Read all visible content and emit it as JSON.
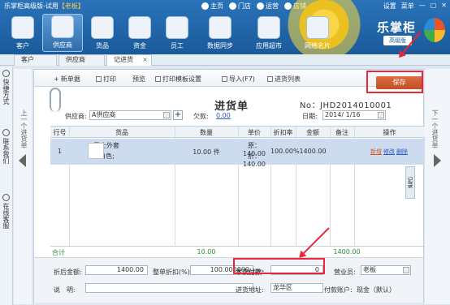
{
  "window": {
    "title": "乐掌柜高级版-试用",
    "demo_tag": "【老板】",
    "controls": [
      "设置",
      "菜单",
      "—",
      "▢",
      "✕"
    ]
  },
  "top_nav": [
    "主页",
    "门店",
    "运营",
    "店铺"
  ],
  "main_nav": [
    {
      "label": "客户",
      "icon": "customer-icon"
    },
    {
      "label": "供应商",
      "icon": "supplier-icon"
    },
    {
      "label": "货品",
      "icon": "goods-icon"
    },
    {
      "label": "资金",
      "icon": "funds-icon"
    },
    {
      "label": "员工",
      "icon": "staff-icon"
    },
    {
      "label": "数据同步",
      "icon": "sync-icon"
    },
    {
      "label": "应用超市",
      "icon": "app-store-icon"
    },
    {
      "label": "网络名片",
      "icon": "business-card-icon"
    }
  ],
  "logo": {
    "name": "乐掌柜",
    "edition": "高级版"
  },
  "tabs": [
    {
      "label": "客户"
    },
    {
      "label": "供应商"
    },
    {
      "label": "记进货",
      "closable": "×"
    }
  ],
  "left_sidebar": [
    "快捷方式",
    "联系我们",
    "在线客服"
  ],
  "pager": {
    "prev": "上一个进货单",
    "next": "下一个进货单"
  },
  "toolbar": {
    "new_order": "新单据",
    "print": "打印",
    "preview": "预览",
    "print_template": "打印模板设置",
    "import": "导入(F7)",
    "order_list": "进货列表",
    "save": "保存"
  },
  "doc": {
    "title": "进货单",
    "number": "No：JHD2014010001",
    "supplier_label": "供应商:",
    "supplier_value": "A供应商",
    "debt_label": "欠款:",
    "debt_value": "0.00",
    "date_label": "日期:",
    "date_value": "2014/ 1/16"
  },
  "grid": {
    "headers": [
      "行号",
      "货品",
      "数量",
      "单价",
      "折扣率",
      "金额",
      "备注",
      "操作"
    ],
    "rows": [
      {
        "line": "1",
        "name": "男士外套",
        "spec": "L;白色;",
        "qty": "10.00 件",
        "price_original": "原：140.00",
        "price_discounted": "折：140.00",
        "discount": "100.00%",
        "amount": "1400.00",
        "note": "",
        "ops": [
          "新增",
          "修改",
          "删除"
        ]
      }
    ]
  },
  "totals": {
    "label": "合计",
    "qty": "10.00",
    "amount": "1400.00"
  },
  "footer": {
    "after_discount_label": "折后金额:",
    "after_discount_value": "1400.00",
    "whole_discount_label": "整单折扣(%)",
    "whole_discount_value": "100.000000",
    "payment_label": "本次付款:",
    "payment_value": "0",
    "salesperson_label": "营业员:",
    "salesperson_value": "老板",
    "remark_label": "说　明:",
    "remark_value": "",
    "address_label": "进货地址:",
    "address_value": "龙华区",
    "account_label": "付款账户:",
    "account_value": "现金（默认）"
  },
  "record_tab": "记录",
  "colors": {
    "accent": "#c24f24",
    "highlight": "#e8283a",
    "header": "#1a5a9a"
  }
}
